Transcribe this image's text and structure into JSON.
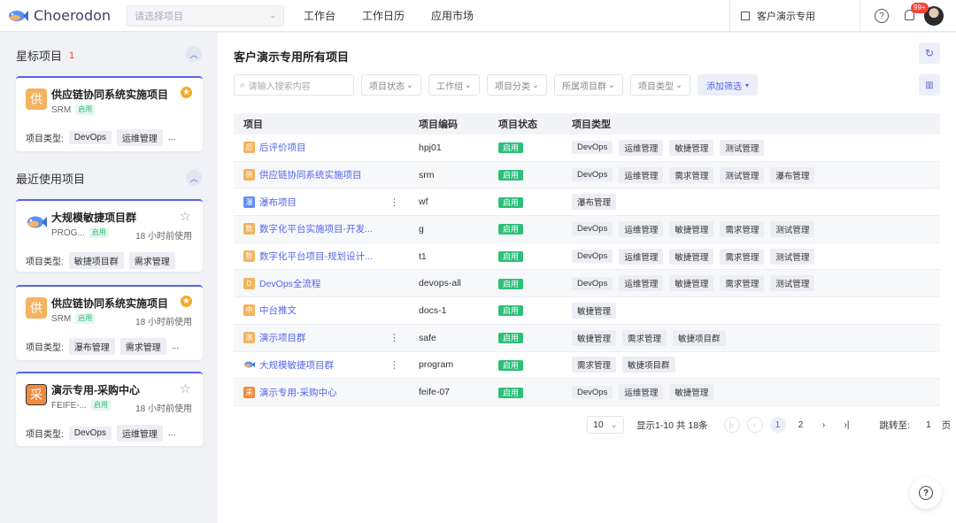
{
  "header": {
    "logo_text": "Choerodon",
    "project_select_placeholder": "请选择项目",
    "nav": [
      "工作台",
      "工作日历",
      "应用市场"
    ],
    "org_name": "客户演示专用",
    "notification_count": "99+"
  },
  "left": {
    "starred_title": "星标项目",
    "starred_count": "1",
    "recent_title": "最近使用项目",
    "type_label": "项目类型:",
    "starred_card": {
      "icon_char": "供",
      "icon_color": "#f4b35f",
      "title": "供应链协同系统实施项目",
      "code": "SRM",
      "status": "启用",
      "types": [
        "DevOps",
        "运维管理",
        "..."
      ]
    },
    "recent_cards": [
      {
        "icon_char": "",
        "icon_kind": "fish",
        "title": "大规模敏捷项目群",
        "code": "PROG...",
        "status": "启用",
        "time": "18 小时前使用",
        "types": [
          "敏捷项目群",
          "需求管理"
        ],
        "starred": false
      },
      {
        "icon_char": "供",
        "icon_color": "#f4b35f",
        "title": "供应链协同系统实施项目",
        "code": "SRM",
        "status": "启用",
        "time": "18 小时前使用",
        "types": [
          "瀑布管理",
          "需求管理",
          "..."
        ],
        "starred": true
      },
      {
        "icon_char": "采",
        "icon_color": "#f08a3c",
        "title": "演示专用-采购中心",
        "code": "FEIFE-...",
        "status": "启用",
        "time": "18 小时前使用",
        "types": [
          "DevOps",
          "运维管理",
          "..."
        ],
        "starred": false
      }
    ]
  },
  "main": {
    "title": "客户演示专用所有项目",
    "search_placeholder": "请输入搜索内容",
    "filters": [
      "项目状态",
      "工作组",
      "项目分类",
      "所属项目群",
      "项目类型"
    ],
    "add_filter": "添加筛选",
    "columns": [
      "项目",
      "项目编码",
      "项目状态",
      "项目类型"
    ],
    "rows": [
      {
        "icon": "后",
        "color": "#f4b35f",
        "name": "后评价项目",
        "code": "hpj01",
        "status": "启用",
        "types": [
          "DevOps",
          "运维管理",
          "敏捷管理",
          "测试管理"
        ],
        "more": false
      },
      {
        "icon": "供",
        "color": "#f4b35f",
        "name": "供应链协同系统实施项目",
        "code": "srm",
        "status": "启用",
        "types": [
          "DevOps",
          "运维管理",
          "需求管理",
          "测试管理",
          "瀑布管理"
        ],
        "more": false
      },
      {
        "icon": "瀑",
        "color": "#5b8ff9",
        "name": "瀑布项目",
        "code": "wf",
        "status": "启用",
        "types": [
          "瀑布管理"
        ],
        "more": true
      },
      {
        "icon": "数",
        "color": "#f4b35f",
        "name": "数字化平台实施项目-开发...",
        "code": "g",
        "status": "启用",
        "types": [
          "DevOps",
          "运维管理",
          "敏捷管理",
          "需求管理",
          "测试管理"
        ],
        "more": false
      },
      {
        "icon": "数",
        "color": "#f4b35f",
        "name": "数字化平台项目-规划设计...",
        "code": "t1",
        "status": "启用",
        "types": [
          "DevOps",
          "运维管理",
          "敏捷管理",
          "需求管理",
          "测试管理"
        ],
        "more": false
      },
      {
        "icon": "D",
        "color": "#f4b35f",
        "name": "DevOps全流程",
        "code": "devops-all",
        "status": "启用",
        "types": [
          "DevOps",
          "运维管理",
          "敏捷管理",
          "需求管理",
          "测试管理"
        ],
        "more": false
      },
      {
        "icon": "中",
        "color": "#f4b35f",
        "name": "中台推文",
        "code": "docs-1",
        "status": "启用",
        "types": [
          "敏捷管理"
        ],
        "more": false
      },
      {
        "icon": "演",
        "color": "#f4b35f",
        "name": "演示项目群",
        "code": "safe",
        "status": "启用",
        "types": [
          "敏捷管理",
          "需求管理",
          "敏捷项目群"
        ],
        "more": true
      },
      {
        "icon": "",
        "color": "",
        "fish": true,
        "name": "大规模敏捷项目群",
        "code": "program",
        "status": "启用",
        "types": [
          "需求管理",
          "敏捷项目群"
        ],
        "more": true
      },
      {
        "icon": "采",
        "color": "#f08a3c",
        "name": "演示专用-采购中心",
        "code": "feife-07",
        "status": "启用",
        "types": [
          "DevOps",
          "运维管理",
          "敏捷管理"
        ],
        "more": false
      }
    ],
    "pager": {
      "page_size": "10",
      "summary": "显示1-10 共 18条",
      "pages": [
        "1",
        "2"
      ],
      "current": "1",
      "jump_label": "跳转至:",
      "jump_value": "1",
      "jump_unit": "页"
    }
  }
}
